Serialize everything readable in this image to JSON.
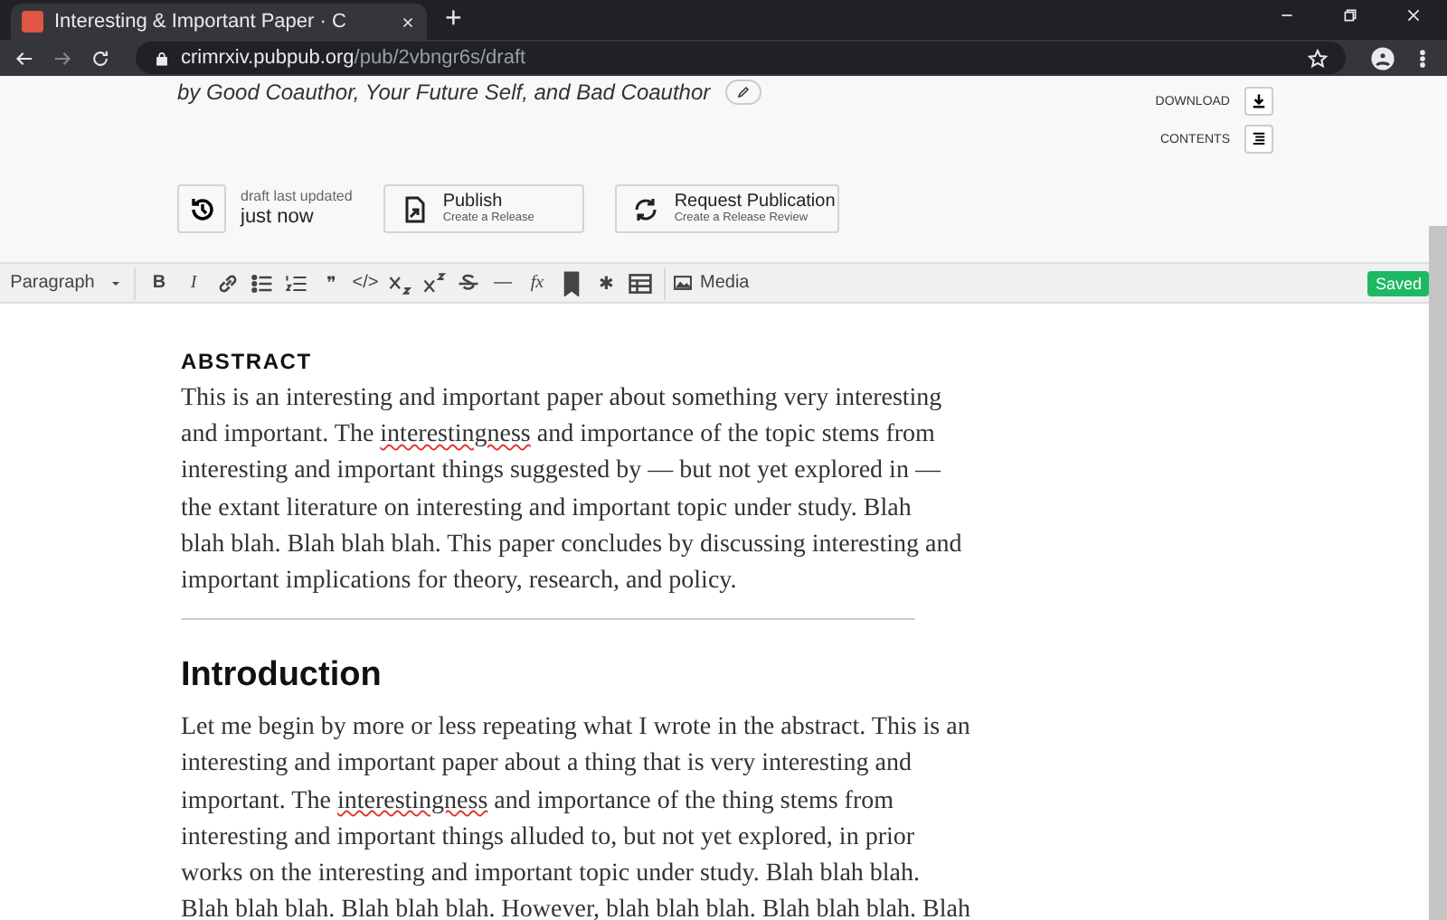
{
  "browser": {
    "tab_title": "Interesting & Important Paper · C",
    "new_tab": "+",
    "url_host": "crimrxiv.pubpub.org",
    "url_path": "/pub/2vbngr6s/draft"
  },
  "header": {
    "byline": "by Good Coauthor, Your Future Self, and Bad Coauthor",
    "side_actions": [
      {
        "label": "DOWNLOAD",
        "kind": "download"
      },
      {
        "label": "CONTENTS",
        "kind": "contents"
      }
    ],
    "status": {
      "caption": "draft last updated",
      "value": "just now"
    },
    "actions": [
      {
        "title": "Publish",
        "subtitle": "Create a Release",
        "kind": "publish"
      },
      {
        "title": "Request Publication",
        "subtitle": "Create a Release Review",
        "kind": "review"
      }
    ]
  },
  "editor_toolbar": {
    "block_type": "Paragraph",
    "tools": [
      {
        "kind": "bold",
        "label": "B"
      },
      {
        "kind": "italic",
        "label": "I"
      },
      {
        "kind": "link"
      },
      {
        "kind": "bullets"
      },
      {
        "kind": "numbers"
      },
      {
        "kind": "quote",
        "label": "❞"
      },
      {
        "kind": "code",
        "label": "</>"
      },
      {
        "kind": "subscript"
      },
      {
        "kind": "superscript"
      },
      {
        "kind": "strike"
      },
      {
        "kind": "rule",
        "label": "—"
      },
      {
        "kind": "formula",
        "label": "fx"
      },
      {
        "kind": "bookmark"
      },
      {
        "kind": "footnote",
        "label": "✱"
      },
      {
        "kind": "table"
      }
    ],
    "media": "Media",
    "save_status": "Saved"
  },
  "document": [
    {
      "kind": "label",
      "text": "ABSTRACT"
    },
    {
      "kind": "paragraph",
      "lines": [
        [
          {
            "text": "This is an interesting and important paper about something very interesting"
          }
        ],
        [
          {
            "text": "and important. The "
          },
          {
            "text": "interestingness",
            "spelling_error": true
          },
          {
            "text": " and importance of the topic stems from"
          }
        ],
        [
          {
            "text": "interesting and important things suggested by — but not yet explored in —"
          }
        ],
        [
          {
            "text": "the extant literature on interesting and important topic under study. Blah"
          }
        ],
        [
          {
            "text": "blah blah. Blah blah blah. This paper concludes by discussing interesting and"
          }
        ],
        [
          {
            "text": "important implications for theory, research, and policy."
          }
        ]
      ]
    },
    {
      "kind": "divider"
    },
    {
      "kind": "heading",
      "text": "Introduction"
    },
    {
      "kind": "paragraph",
      "lines": [
        [
          {
            "text": "Let me begin by more or less repeating what I wrote in the abstract. This is an"
          }
        ],
        [
          {
            "text": "interesting and important paper about a thing that is very interesting and"
          }
        ],
        [
          {
            "text": "important. The "
          },
          {
            "text": "interestingness",
            "spelling_error": true
          },
          {
            "text": " and importance of the thing stems from"
          }
        ],
        [
          {
            "text": "interesting and important things alluded to, but not yet explored, in prior"
          }
        ],
        [
          {
            "text": "works on the interesting and important topic under study. Blah blah blah."
          }
        ],
        [
          {
            "text": "Blah blah blah. Blah blah blah. However, blah blah blah. Blah blah blah. Blah"
          }
        ]
      ]
    }
  ]
}
